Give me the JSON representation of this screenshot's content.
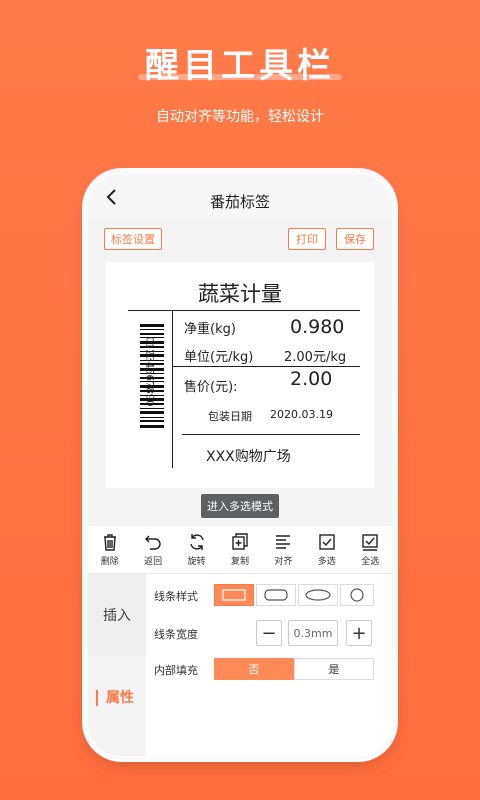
{
  "hero": {
    "title": "醒目工具栏",
    "subtitle": "自动对齐等功能，轻松设计"
  },
  "nav": {
    "title": "番茄标签"
  },
  "actions": {
    "label_settings": "标签设置",
    "print": "打印",
    "save": "保存"
  },
  "label": {
    "title": "蔬菜计量",
    "net_weight_label": "净重(kg)",
    "net_weight_value": "0.980",
    "unit_label": "单位(元/kg)",
    "unit_value": "2.00元/kg",
    "price_label": "售价(元):",
    "price_value": "2.00",
    "pack_date_label": "包装日期",
    "pack_date_value": "2020.03.19",
    "store": "XXX购物广场",
    "barcode_number": "01234567890"
  },
  "multi_select_mode": "进入多选模式",
  "toolbar": {
    "items": [
      {
        "label": "删除",
        "icon": "trash-icon"
      },
      {
        "label": "返回",
        "icon": "undo-icon"
      },
      {
        "label": "旋转",
        "icon": "rotate-icon"
      },
      {
        "label": "复制",
        "icon": "copy-icon"
      },
      {
        "label": "对齐",
        "icon": "align-icon"
      },
      {
        "label": "多选",
        "icon": "checkbox-icon"
      },
      {
        "label": "全选",
        "icon": "select-all-icon"
      }
    ]
  },
  "side": {
    "insert": "插入",
    "attributes": "属性"
  },
  "panel": {
    "line_style_label": "线条样式",
    "line_width_label": "线条宽度",
    "line_width_value": "0.3mm",
    "fill_label": "内部填充",
    "fill_no": "否",
    "fill_yes": "是",
    "minus": "−",
    "plus": "+"
  },
  "colors": {
    "accent": "#ff7a4a",
    "dark_button": "#5e6064"
  }
}
